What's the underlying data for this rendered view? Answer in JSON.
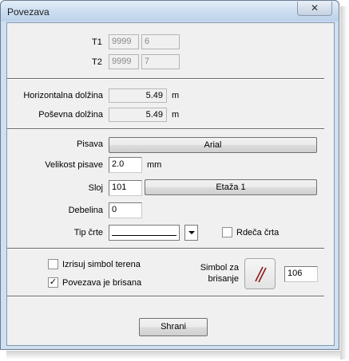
{
  "window": {
    "title": "Povezava",
    "close_icon": "close-icon"
  },
  "t1": {
    "label": "T1",
    "value1": "9999",
    "value2": "6"
  },
  "t2": {
    "label": "T2",
    "value1": "9999",
    "value2": "7"
  },
  "horizontal": {
    "label": "Horizontalna dolžina",
    "value": "5.49",
    "unit": "m"
  },
  "sloped": {
    "label": "Poševna dolžina",
    "value": "5.49",
    "unit": "m"
  },
  "font": {
    "label": "Pisava",
    "value": "Arial"
  },
  "font_size": {
    "label": "Velikost pisave",
    "value": "2.0",
    "unit": "mm"
  },
  "layer": {
    "label": "Sloj",
    "value": "101",
    "button": "Etaža 1"
  },
  "thickness": {
    "label": "Debelina",
    "value": "0"
  },
  "line_type": {
    "label": "Tip črte",
    "selected": "solid line"
  },
  "red_line": {
    "label": "Rdeča črta",
    "checked": false
  },
  "terrain_symbol": {
    "label": "Izrisuj simbol terena",
    "checked": false
  },
  "deleted_link": {
    "label": "Povezava je brisana",
    "checked": true
  },
  "delete_symbol": {
    "label_line1": "Simbol za",
    "label_line2": "brisanje",
    "value": "106",
    "icon": "double-slash-icon",
    "color": "#8b1a1a"
  },
  "save_button": "Shrani"
}
